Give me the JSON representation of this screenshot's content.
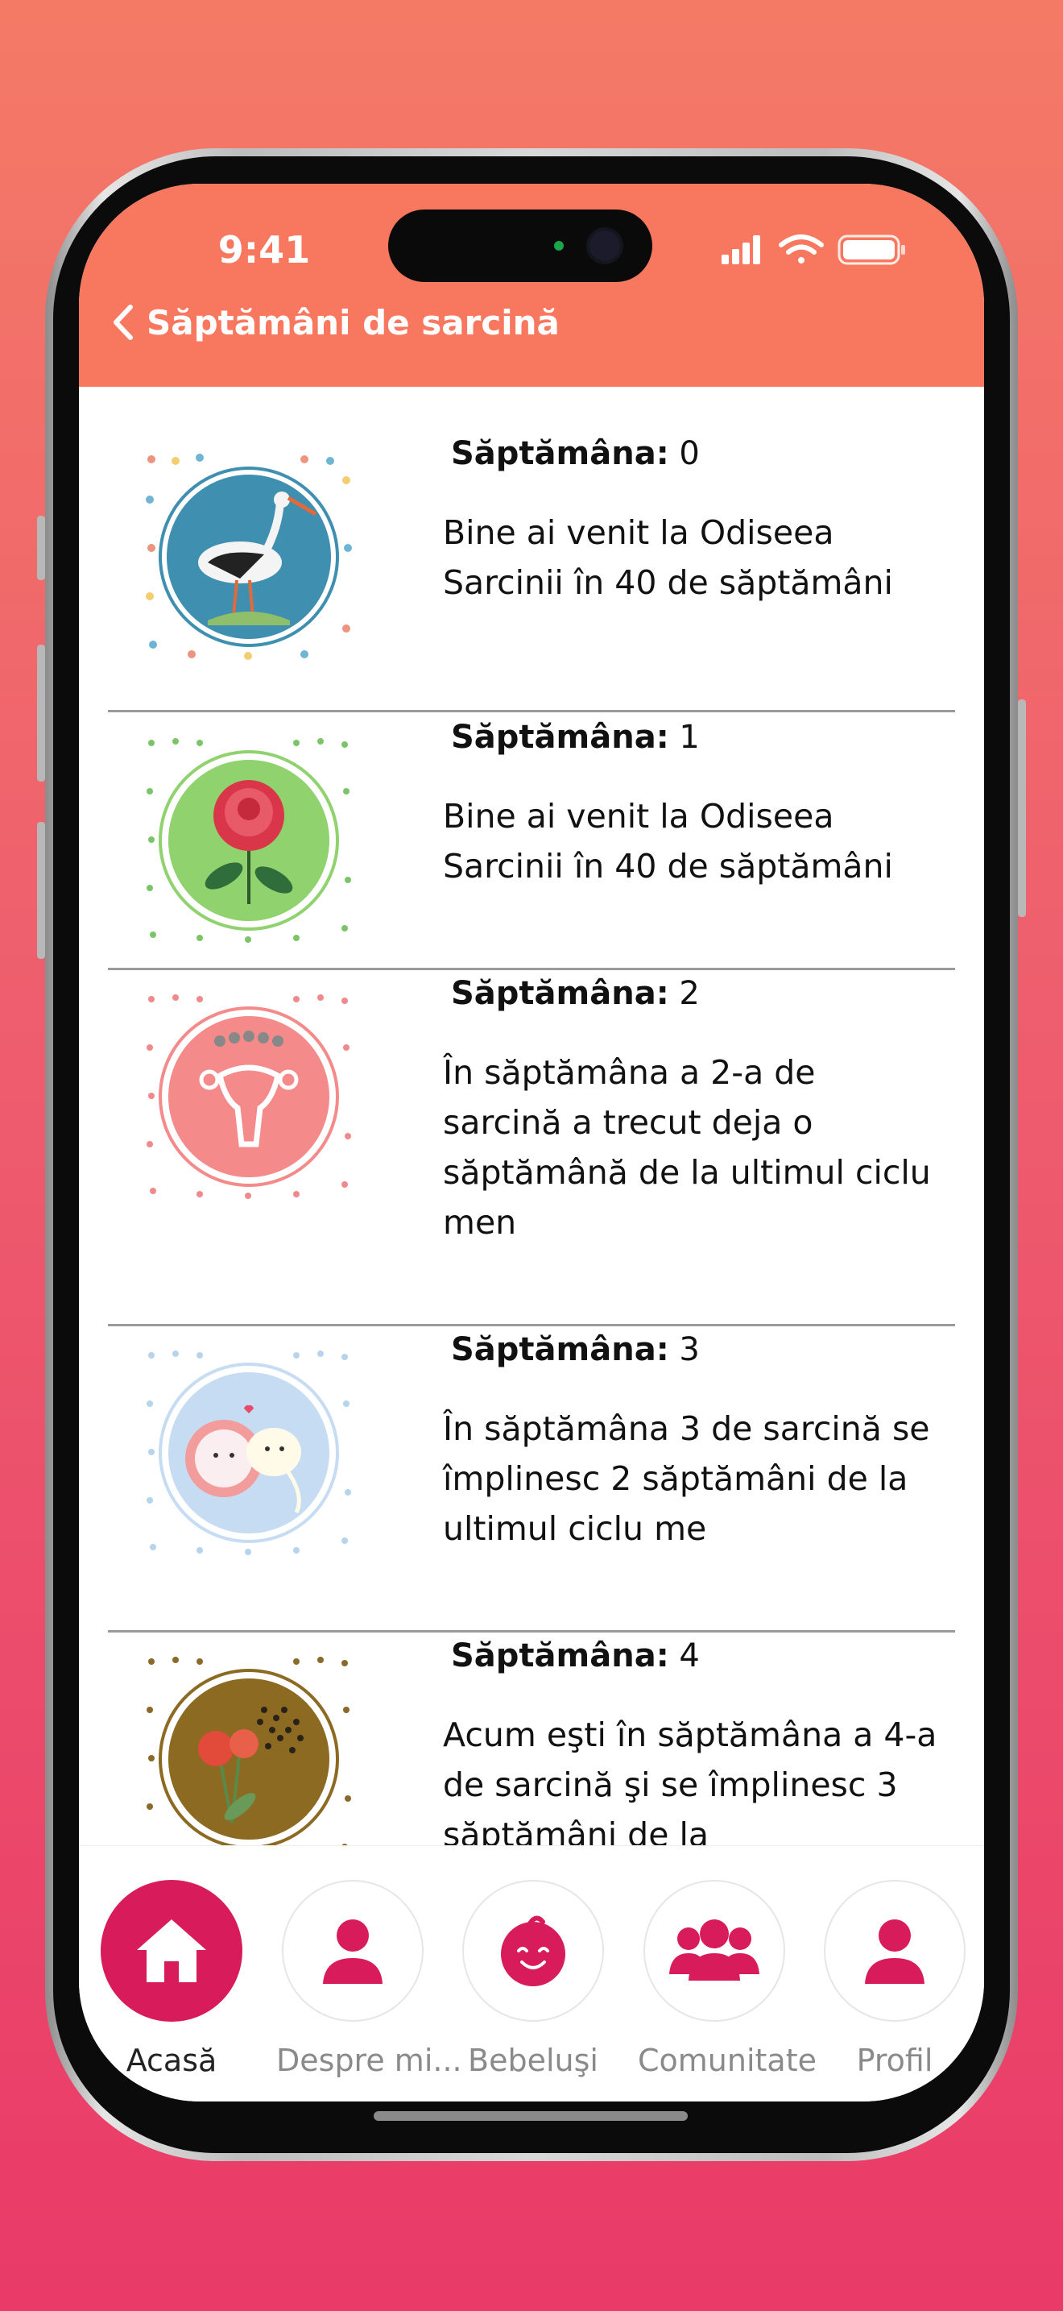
{
  "status_bar": {
    "time": "9:41"
  },
  "header": {
    "back_icon": "chevron-left-icon",
    "title": "Săptămâni de sarcină"
  },
  "colors": {
    "header": "#f7785f",
    "accent": "#d81b5b",
    "background_top": "#f47a66",
    "background_bottom": "#e93a68"
  },
  "weeks": [
    {
      "label": "Săptămâna:",
      "number": "0",
      "lines": [
        "Bine ai venit la Odiseea",
        "Sarcinii în 40 de săptămâni"
      ],
      "image": "stork-illustration"
    },
    {
      "label": "Săptămâna:",
      "number": "1",
      "lines": [
        "Bine ai venit la Odiseea",
        "Sarcinii în 40 de săptămâni"
      ],
      "image": "rose-illustration"
    },
    {
      "label": "Săptămâna:",
      "number": "2",
      "lines": [
        "În săptămâna a 2-a de",
        "sarcină a trecut deja o",
        "săptămână de la ultimul ciclu",
        "men"
      ],
      "image": "uterus-illustration"
    },
    {
      "label": "Săptămâna:",
      "number": "3",
      "lines": [
        "În săptămâna 3 de sarcină se",
        "împlinesc 2 săptămâni de la",
        "ultimul ciclu me"
      ],
      "image": "cells-illustration"
    },
    {
      "label": "Săptămâna:",
      "number": "4",
      "lines": [
        "Acum eşti în săptămâna a 4-a",
        "de sarcină şi se împlinesc 3",
        "săptămâni de la"
      ],
      "image": "poppy-illustration"
    }
  ],
  "tabs": [
    {
      "label": "Acasă",
      "icon": "home-icon",
      "active": true
    },
    {
      "label": "Despre mi...",
      "icon": "person-icon",
      "active": false
    },
    {
      "label": "Bebeluşi",
      "icon": "baby-face-icon",
      "active": false
    },
    {
      "label": "Comunitate",
      "icon": "group-icon",
      "active": false
    },
    {
      "label": "Profil",
      "icon": "profile-icon",
      "active": false
    }
  ]
}
